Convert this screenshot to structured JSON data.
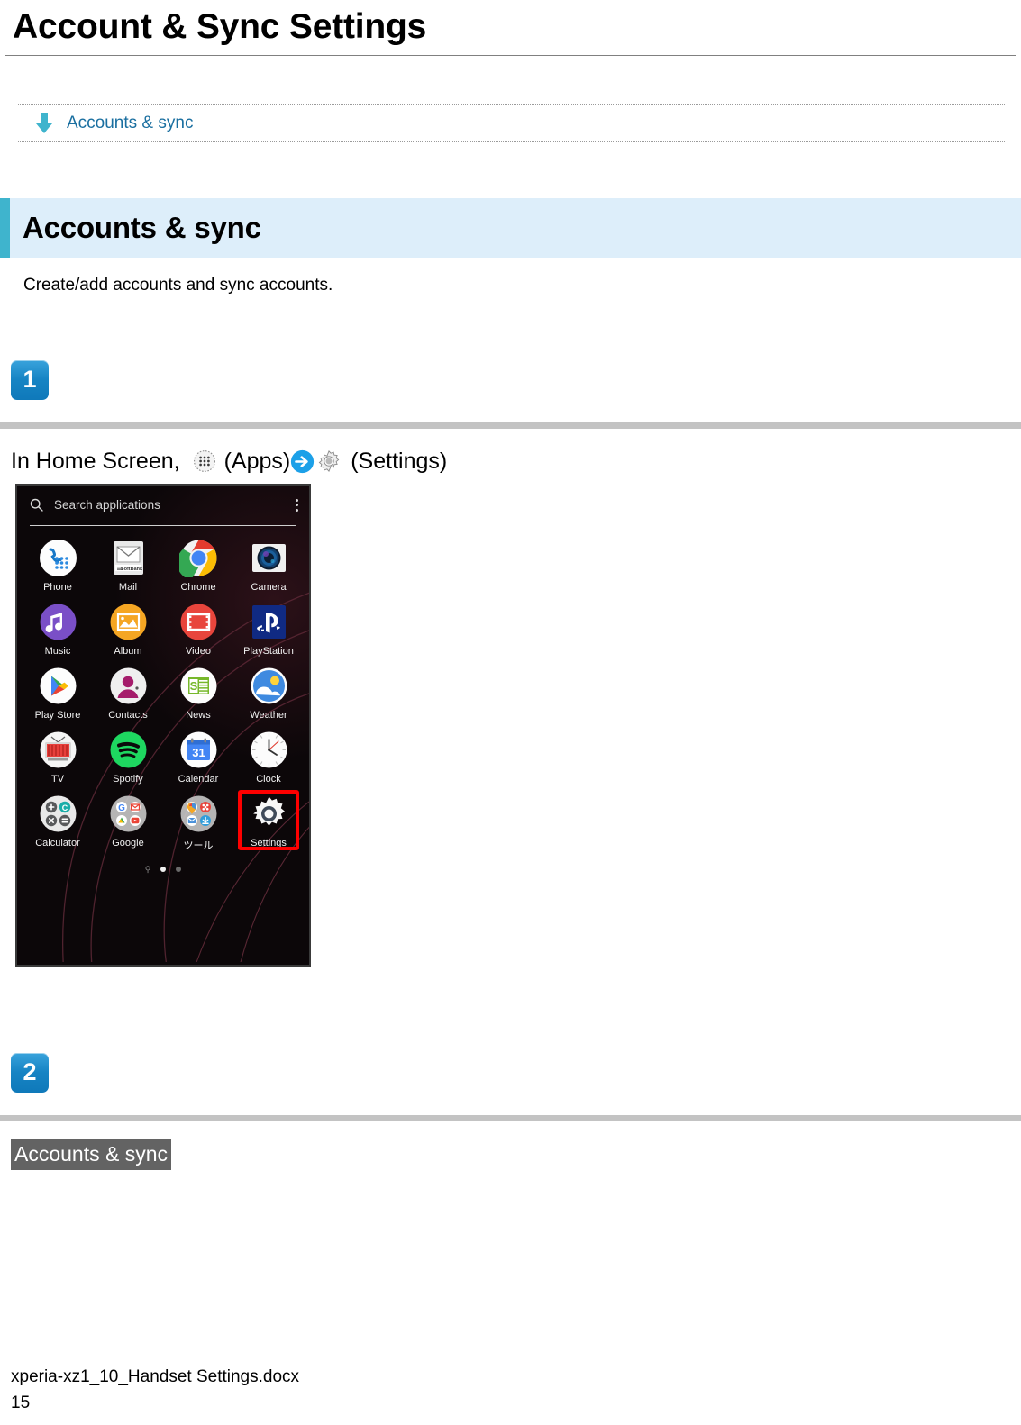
{
  "document": {
    "title": "Account & Sync Settings",
    "footer_filename": "xperia-xz1_10_Handset Settings.docx",
    "footer_page": "15"
  },
  "breadcrumb": {
    "arrow_icon": "down-arrow-icon",
    "label": "Accounts & sync"
  },
  "section": {
    "banner_title": "Accounts & sync",
    "description": "Create/add accounts and sync accounts.",
    "accent_color": "#3fb4cd",
    "background_color": "#ddeefa"
  },
  "steps": [
    {
      "number": "1",
      "instruction_prefix": "In Home Screen,",
      "apps_icon": "apps-grid-icon",
      "apps_label": "(Apps)",
      "arrow_icon": "right-arrow-circle-icon",
      "settings_icon": "gear-icon",
      "settings_label": "(Settings)"
    },
    {
      "number": "2",
      "highlight_text": "Accounts & sync",
      "highlight_bg": "#636363"
    }
  ],
  "phone_screenshot": {
    "search": {
      "icon": "search-icon",
      "placeholder": "Search applications",
      "overflow_icon": "kebab-menu-icon"
    },
    "apps": [
      {
        "label": "Phone",
        "icon": "phone-icon"
      },
      {
        "label": "Mail",
        "icon": "mail-icon"
      },
      {
        "label": "Chrome",
        "icon": "chrome-icon"
      },
      {
        "label": "Camera",
        "icon": "camera-icon"
      },
      {
        "label": "Music",
        "icon": "music-icon"
      },
      {
        "label": "Album",
        "icon": "album-icon"
      },
      {
        "label": "Video",
        "icon": "video-icon"
      },
      {
        "label": "PlayStation",
        "icon": "playstation-icon"
      },
      {
        "label": "Play Store",
        "icon": "play-store-icon"
      },
      {
        "label": "Contacts",
        "icon": "contacts-icon"
      },
      {
        "label": "News",
        "icon": "news-icon"
      },
      {
        "label": "Weather",
        "icon": "weather-icon"
      },
      {
        "label": "TV",
        "icon": "tv-icon"
      },
      {
        "label": "Spotify",
        "icon": "spotify-icon"
      },
      {
        "label": "Calendar",
        "icon": "calendar-icon"
      },
      {
        "label": "Clock",
        "icon": "clock-icon"
      },
      {
        "label": "Calculator",
        "icon": "calculator-icon"
      },
      {
        "label": "Google",
        "icon": "google-folder-icon"
      },
      {
        "label": "ツール",
        "icon": "tools-folder-icon"
      },
      {
        "label": "Settings",
        "icon": "settings-gear-icon",
        "highlighted": true
      }
    ],
    "calendar_day": "31",
    "highlight_color": "#ff0000",
    "page_indicator": {
      "total": 2,
      "active": 1
    }
  }
}
